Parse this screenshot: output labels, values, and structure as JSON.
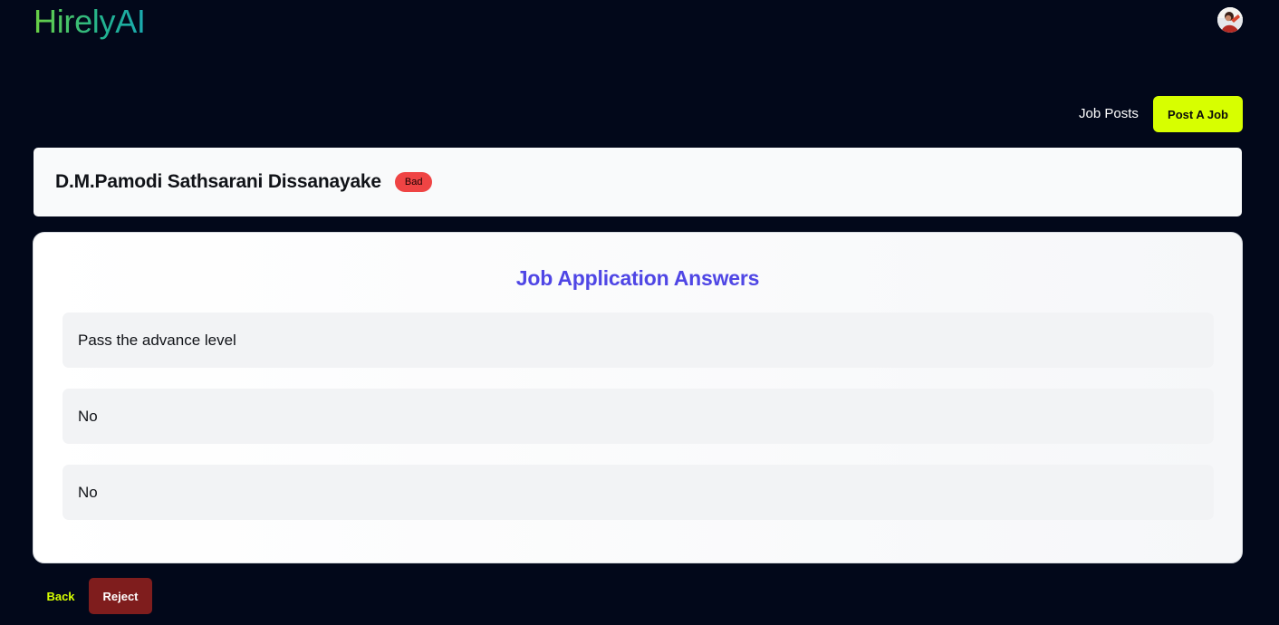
{
  "app": {
    "logo_text": "HirelyAI",
    "brand_gradient": [
      "#6ad043",
      "#1aa9b0"
    ]
  },
  "header": {
    "avatar_icon": "user-avatar",
    "nav": {
      "job_posts_label": "Job Posts",
      "post_job_label": "Post A Job"
    }
  },
  "candidate": {
    "name": "D.M.Pamodi Sathsarani Dissanayake",
    "rating_badge": "Bad",
    "rating_color": "#ef4444"
  },
  "answers": {
    "title": "Job Application Answers",
    "items": [
      "Pass the advance level",
      "No",
      "No"
    ]
  },
  "actions": {
    "back_label": "Back",
    "reject_label": "Reject",
    "accent": "#d7ff00",
    "reject_color": "#7f1d1d"
  }
}
